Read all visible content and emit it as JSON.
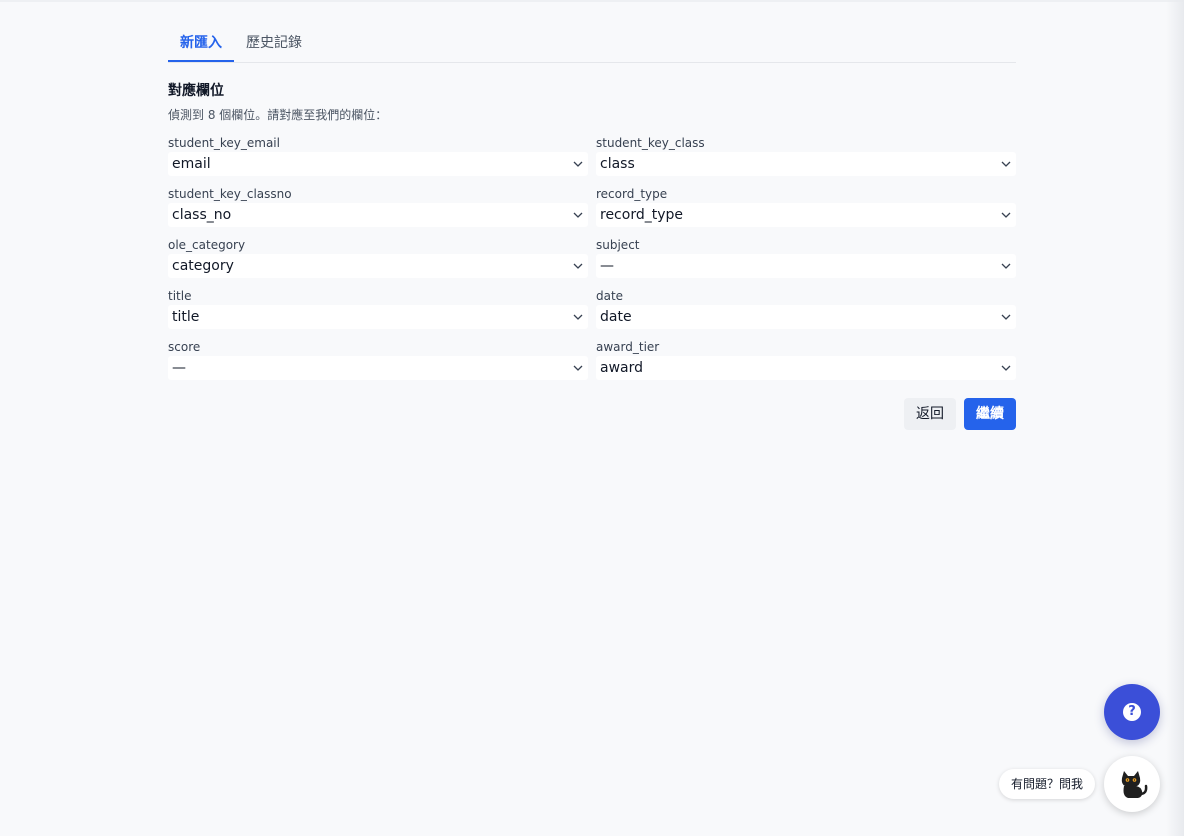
{
  "tabs": [
    {
      "label": "新匯入",
      "active": true
    },
    {
      "label": "歷史記錄",
      "active": false
    }
  ],
  "section": {
    "title": "對應欄位",
    "description": "偵測到 8 個欄位。請對應至我們的欄位："
  },
  "fields": [
    {
      "label": "student_key_email",
      "value": "email"
    },
    {
      "label": "student_key_class",
      "value": "class"
    },
    {
      "label": "student_key_classno",
      "value": "class_no"
    },
    {
      "label": "record_type",
      "value": "record_type"
    },
    {
      "label": "ole_category",
      "value": "category"
    },
    {
      "label": "subject",
      "value": "—"
    },
    {
      "label": "title",
      "value": "title"
    },
    {
      "label": "date",
      "value": "date"
    },
    {
      "label": "score",
      "value": "—"
    },
    {
      "label": "award_tier",
      "value": "award"
    }
  ],
  "actions": {
    "back_label": "返回",
    "continue_label": "繼續"
  },
  "help": {
    "fab_icon": "question-icon",
    "chat_label": "有問題？問我",
    "assistant_icon": "cat-icon"
  },
  "colors": {
    "accent": "#2563eb",
    "fab": "#3b4fd8",
    "background": "#f8f9fb"
  }
}
